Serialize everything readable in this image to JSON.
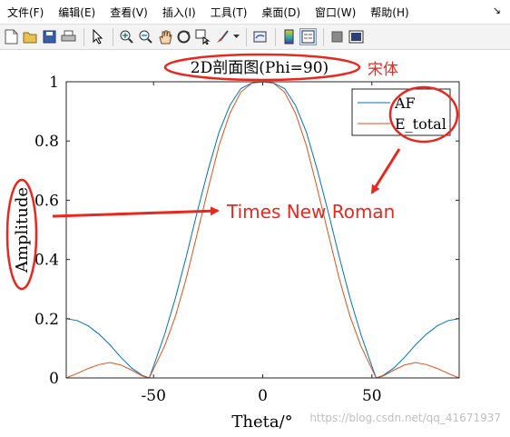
{
  "menu": {
    "items": [
      "文件(F)",
      "编辑(E)",
      "查看(V)",
      "插入(I)",
      "工具(T)",
      "桌面(D)",
      "窗口(W)",
      "帮助(H)"
    ],
    "overflow_arrow": "↘"
  },
  "toolbar": {
    "icons": [
      "new-file-icon",
      "open-folder-icon",
      "save-icon",
      "print-icon",
      "pointer-icon",
      "zoom-in-icon",
      "zoom-out-icon",
      "pan-hand-icon",
      "rotate-3d-icon",
      "data-cursor-icon",
      "brush-icon",
      "link-plot-icon",
      "colorbar-icon",
      "legend-icon",
      "hide-plot-tools-icon",
      "show-plot-tools-icon"
    ]
  },
  "chart_data": {
    "type": "line",
    "title": "2D剖面图(Phi=90)",
    "xlabel": "Theta/°",
    "ylabel": "Amplitude",
    "xlim": [
      -90,
      90
    ],
    "ylim": [
      0,
      1
    ],
    "xticks": [
      -50,
      0,
      50
    ],
    "yticks": [
      0,
      0.2,
      0.4,
      0.6,
      0.8,
      1
    ],
    "ytick_labels": [
      "0",
      "0.2",
      "0.4",
      "0.6",
      "0.8",
      "1"
    ],
    "grid": false,
    "legend_position": "top-right",
    "series": [
      {
        "name": "AF",
        "color": "#0072BD",
        "x": [
          -90,
          -85,
          -80,
          -75,
          -70,
          -65,
          -60,
          -55,
          -52,
          -50,
          -45,
          -40,
          -35,
          -30,
          -25,
          -20,
          -15,
          -10,
          -5,
          0,
          5,
          10,
          15,
          20,
          25,
          30,
          35,
          40,
          45,
          50,
          52,
          55,
          60,
          65,
          70,
          75,
          80,
          85,
          90
        ],
        "y": [
          0.2,
          0.194,
          0.176,
          0.148,
          0.112,
          0.07,
          0.033,
          0.008,
          0,
          0.04,
          0.146,
          0.27,
          0.41,
          0.56,
          0.703,
          0.83,
          0.921,
          0.977,
          0.996,
          1,
          0.996,
          0.977,
          0.921,
          0.83,
          0.703,
          0.56,
          0.41,
          0.27,
          0.146,
          0.04,
          0,
          0.008,
          0.033,
          0.07,
          0.112,
          0.148,
          0.176,
          0.194,
          0.2
        ]
      },
      {
        "name": "E_total",
        "color": "#D95319",
        "x": [
          -90,
          -85,
          -80,
          -75,
          -70,
          -65,
          -60,
          -55,
          -52,
          -50,
          -45,
          -40,
          -35,
          -30,
          -25,
          -20,
          -15,
          -10,
          -5,
          0,
          5,
          10,
          15,
          20,
          25,
          30,
          35,
          40,
          45,
          50,
          52,
          55,
          60,
          65,
          70,
          75,
          80,
          85,
          90
        ],
        "y": [
          0,
          0.015,
          0.032,
          0.045,
          0.052,
          0.044,
          0.026,
          0.006,
          0,
          0.03,
          0.107,
          0.208,
          0.337,
          0.487,
          0.64,
          0.785,
          0.894,
          0.965,
          0.995,
          1,
          0.995,
          0.965,
          0.894,
          0.785,
          0.64,
          0.487,
          0.337,
          0.208,
          0.107,
          0.03,
          0,
          0.006,
          0.026,
          0.044,
          0.052,
          0.045,
          0.032,
          0.015,
          0
        ]
      }
    ]
  },
  "annotations": {
    "font_note": "宋体",
    "axis_font_note": "Times New Roman",
    "color": "#e8281e"
  },
  "watermark": "https://blog.csdn.net/qq_41671937"
}
